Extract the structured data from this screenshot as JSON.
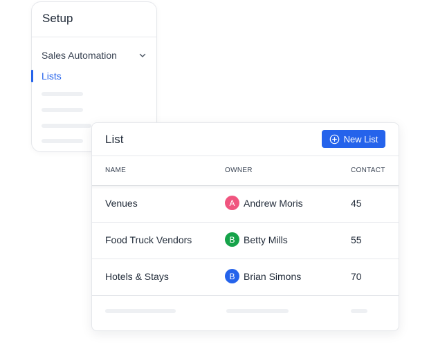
{
  "setup": {
    "title": "Setup",
    "nav_items": [
      {
        "label": "Sales Automation",
        "icon": "chevron-down-icon"
      },
      {
        "label": "Lists",
        "active": true
      }
    ]
  },
  "list": {
    "title": "List",
    "new_button_label": "New List",
    "new_button_icon": "plus-circle-icon",
    "columns": [
      "NAME",
      "OWNER",
      "CONTACT"
    ],
    "rows": [
      {
        "name": "Venues",
        "owner": "Andrew Moris",
        "initial": "A",
        "avatar_color": "#f0557f",
        "contact": "45"
      },
      {
        "name": "Food Truck Vendors",
        "owner": "Betty Mills",
        "initial": "B",
        "avatar_color": "#16a34a",
        "contact": "55"
      },
      {
        "name": "Hotels & Stays",
        "owner": "Brian Simons",
        "initial": "B",
        "avatar_color": "#2563eb",
        "contact": "70"
      }
    ]
  },
  "colors": {
    "accent": "#2563eb",
    "border": "#e5e7eb",
    "skeleton": "#eef0f3"
  }
}
